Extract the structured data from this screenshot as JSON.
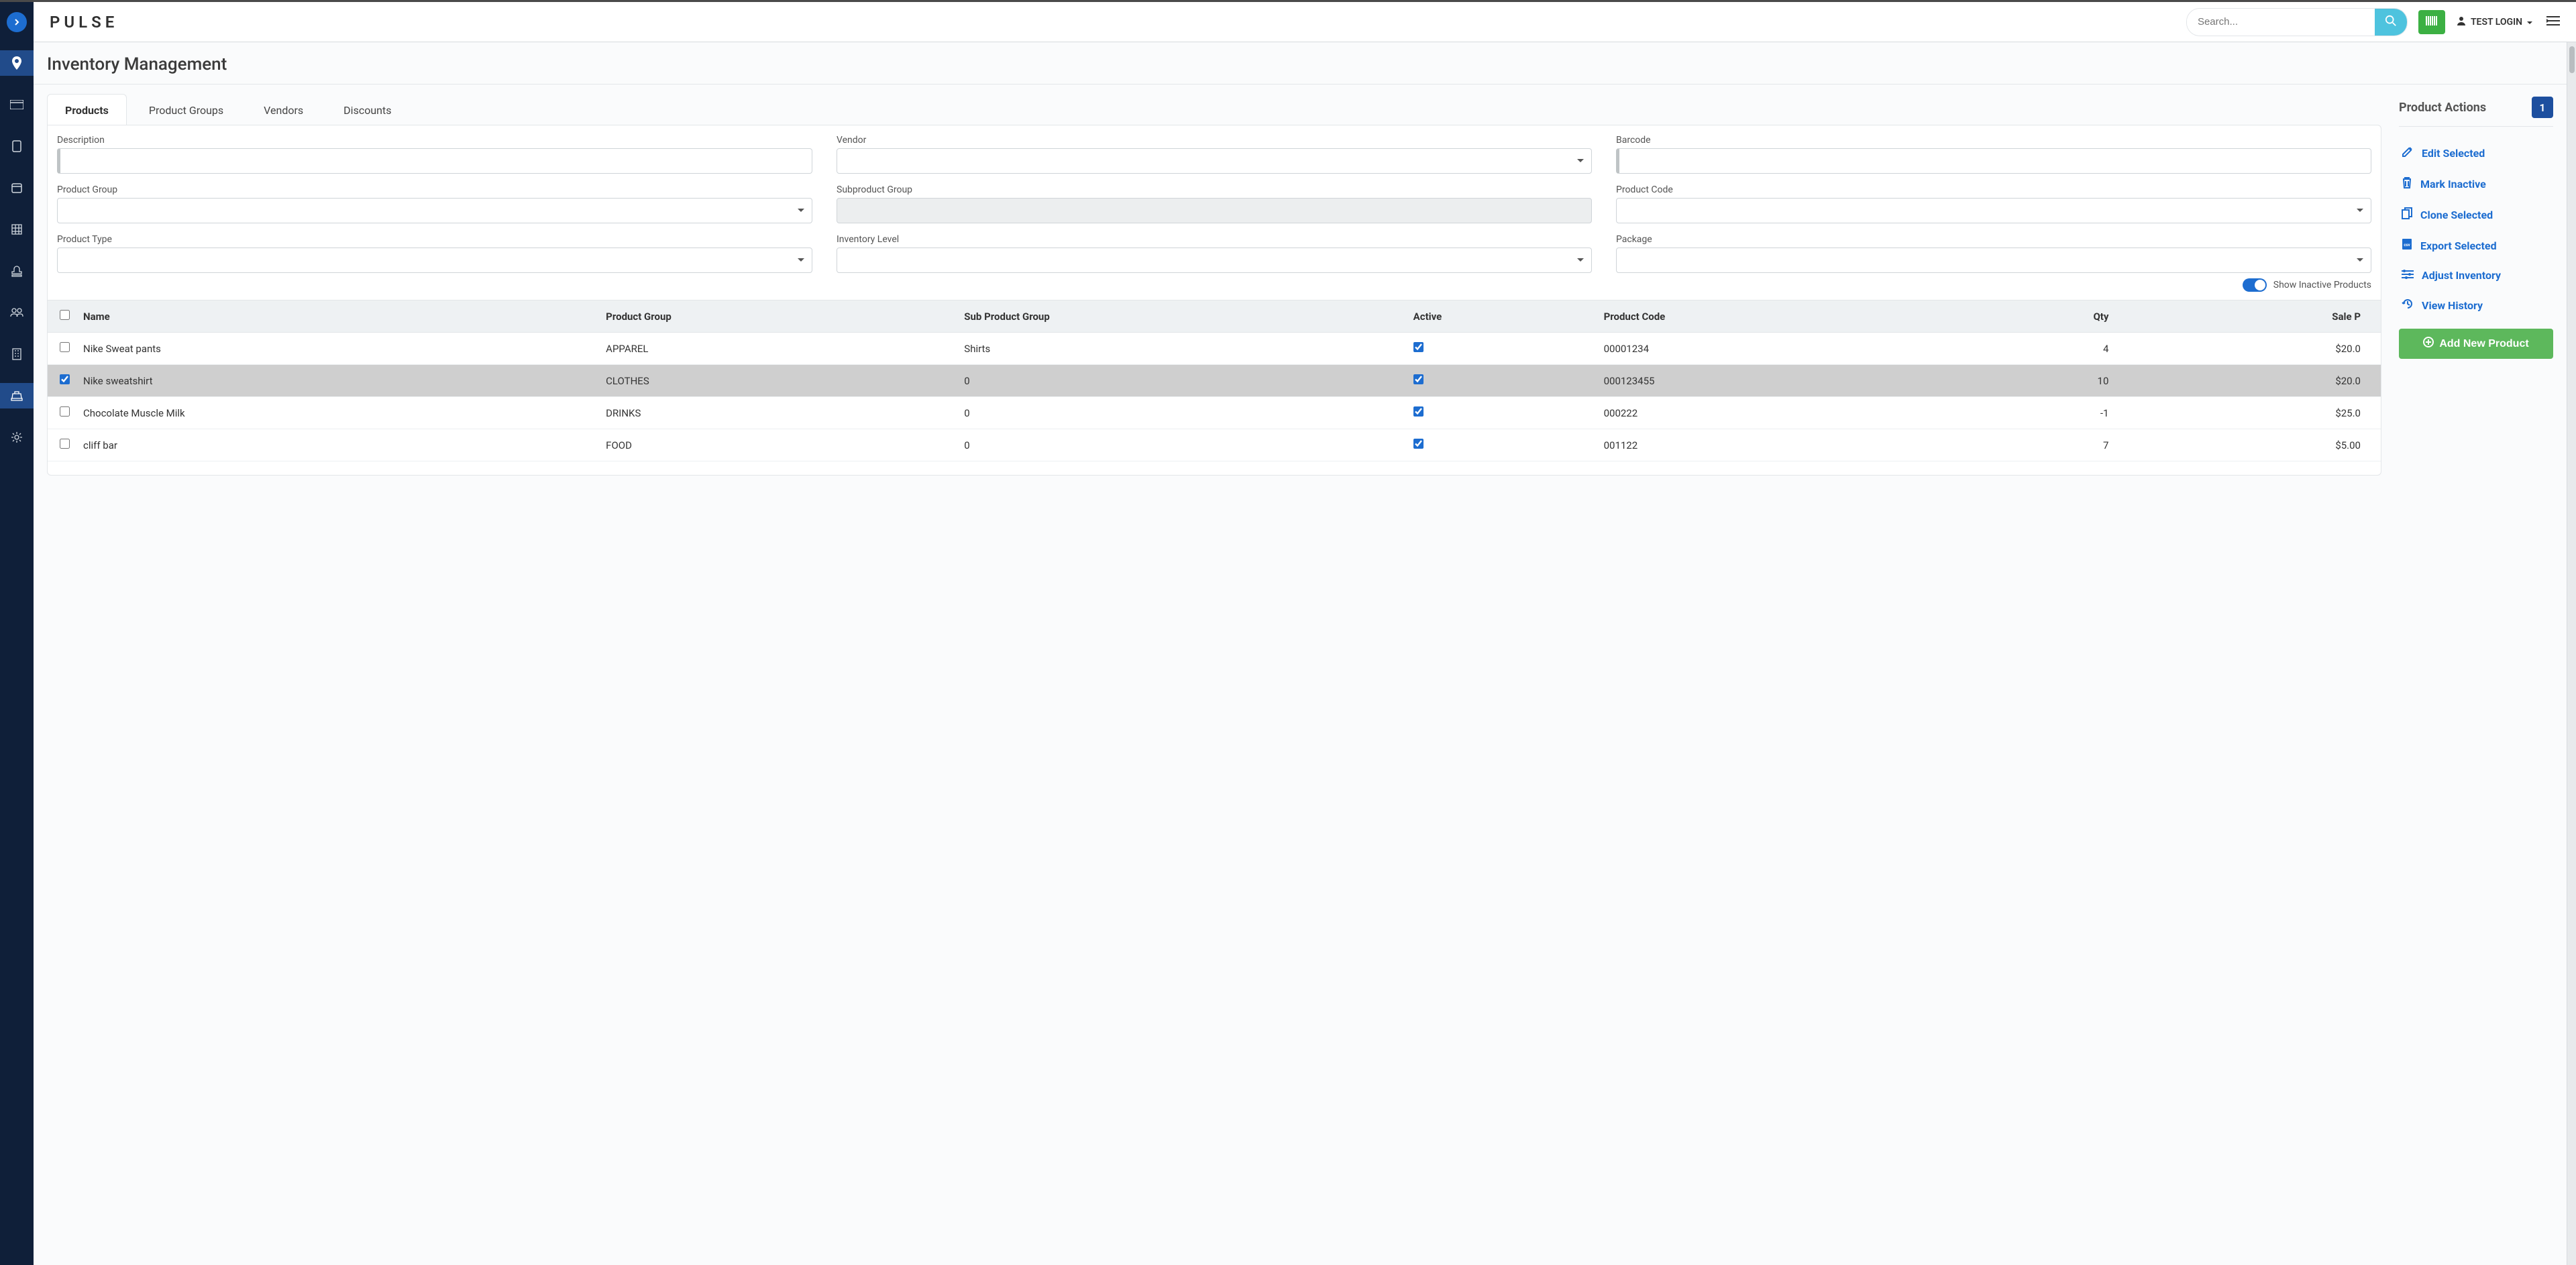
{
  "brand": "PULSE",
  "header": {
    "search_placeholder": "Search...",
    "user_label": "TEST LOGIN"
  },
  "page_title": "Inventory Management",
  "tabs": [
    "Products",
    "Product Groups",
    "Vendors",
    "Discounts"
  ],
  "filters": {
    "description": "Description",
    "vendor": "Vendor",
    "barcode": "Barcode",
    "product_group": "Product Group",
    "subproduct_group": "Subproduct Group",
    "product_code": "Product Code",
    "product_type": "Product Type",
    "inventory_level": "Inventory Level",
    "package": "Package"
  },
  "toggle_label": "Show Inactive Products",
  "table": {
    "columns": [
      "Name",
      "Product Group",
      "Sub Product Group",
      "Active",
      "Product Code",
      "Qty",
      "Sale Price"
    ],
    "qty_header_short": "Qty",
    "sale_header_cut": "Sale P",
    "rows": [
      {
        "selected": false,
        "name": "Nike Sweat pants",
        "group": "APPAREL",
        "sub": "Shirts",
        "active": true,
        "code": "00001234",
        "qty": "4",
        "price": "$20.0"
      },
      {
        "selected": true,
        "name": "Nike sweatshirt",
        "group": "CLOTHES",
        "sub": "0",
        "active": true,
        "code": "000123455",
        "qty": "10",
        "price": "$20.0"
      },
      {
        "selected": false,
        "name": "Chocolate Muscle Milk",
        "group": "DRINKS",
        "sub": "0",
        "active": true,
        "code": "000222",
        "qty": "-1",
        "price": "$25.0"
      },
      {
        "selected": false,
        "name": "cliff bar",
        "group": "FOOD",
        "sub": "0",
        "active": true,
        "code": "001122",
        "qty": "7",
        "price": "$5.00"
      }
    ]
  },
  "actions": {
    "title": "Product Actions",
    "count": "1",
    "edit": "Edit Selected",
    "inactive": "Mark Inactive",
    "clone": "Clone Selected",
    "export": "Export Selected",
    "adjust": "Adjust Inventory",
    "history": "View History",
    "add": "Add New Product"
  }
}
